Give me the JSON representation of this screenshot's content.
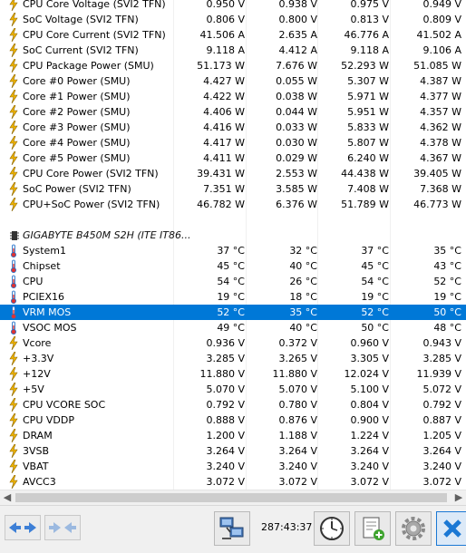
{
  "rows": [
    {
      "icon": "bolt-icon",
      "label": "CPU Core Voltage (SVI2 TFN)",
      "values": [
        "0.950 V",
        "0.938 V",
        "0.975 V",
        "0.949 V"
      ]
    },
    {
      "icon": "bolt-icon",
      "label": "SoC Voltage (SVI2 TFN)",
      "values": [
        "0.806 V",
        "0.800 V",
        "0.813 V",
        "0.809 V"
      ]
    },
    {
      "icon": "bolt-icon",
      "label": "CPU Core Current (SVI2 TFN)",
      "values": [
        "41.506 A",
        "2.635 A",
        "46.776 A",
        "41.502 A"
      ]
    },
    {
      "icon": "bolt-icon",
      "label": "SoC Current (SVI2 TFN)",
      "values": [
        "9.118 A",
        "4.412 A",
        "9.118 A",
        "9.106 A"
      ]
    },
    {
      "icon": "bolt-icon",
      "label": "CPU Package Power (SMU)",
      "values": [
        "51.173 W",
        "7.676 W",
        "52.293 W",
        "51.085 W"
      ]
    },
    {
      "icon": "bolt-icon",
      "label": "Core #0 Power (SMU)",
      "values": [
        "4.427 W",
        "0.055 W",
        "5.307 W",
        "4.387 W"
      ]
    },
    {
      "icon": "bolt-icon",
      "label": "Core #1 Power (SMU)",
      "values": [
        "4.422 W",
        "0.038 W",
        "5.971 W",
        "4.377 W"
      ]
    },
    {
      "icon": "bolt-icon",
      "label": "Core #2 Power (SMU)",
      "values": [
        "4.406 W",
        "0.044 W",
        "5.951 W",
        "4.357 W"
      ]
    },
    {
      "icon": "bolt-icon",
      "label": "Core #3 Power (SMU)",
      "values": [
        "4.416 W",
        "0.033 W",
        "5.833 W",
        "4.362 W"
      ]
    },
    {
      "icon": "bolt-icon",
      "label": "Core #4 Power (SMU)",
      "values": [
        "4.417 W",
        "0.030 W",
        "5.807 W",
        "4.378 W"
      ]
    },
    {
      "icon": "bolt-icon",
      "label": "Core #5 Power (SMU)",
      "values": [
        "4.411 W",
        "0.029 W",
        "6.240 W",
        "4.367 W"
      ]
    },
    {
      "icon": "bolt-icon",
      "label": "CPU Core Power (SVI2 TFN)",
      "values": [
        "39.431 W",
        "2.553 W",
        "44.438 W",
        "39.405 W"
      ]
    },
    {
      "icon": "bolt-icon",
      "label": "SoC Power (SVI2 TFN)",
      "values": [
        "7.351 W",
        "3.585 W",
        "7.408 W",
        "7.368 W"
      ]
    },
    {
      "icon": "bolt-icon",
      "label": "CPU+SoC Power (SVI2 TFN)",
      "values": [
        "46.782 W",
        "6.376 W",
        "51.789 W",
        "46.773 W"
      ]
    },
    {
      "type": "blank"
    },
    {
      "type": "header",
      "icon": "chip-icon",
      "label": "GIGABYTE B450M S2H (ITE IT86..."
    },
    {
      "icon": "thermometer-icon",
      "label": "System1",
      "values": [
        "37 °C",
        "32 °C",
        "37 °C",
        "35 °C"
      ]
    },
    {
      "icon": "thermometer-icon",
      "label": "Chipset",
      "values": [
        "45 °C",
        "40 °C",
        "45 °C",
        "43 °C"
      ]
    },
    {
      "icon": "thermometer-icon",
      "label": "CPU",
      "values": [
        "54 °C",
        "26 °C",
        "54 °C",
        "52 °C"
      ]
    },
    {
      "icon": "thermometer-icon",
      "label": "PCIEX16",
      "values": [
        "19 °C",
        "18 °C",
        "19 °C",
        "19 °C"
      ]
    },
    {
      "icon": "thermometer-icon",
      "label": "VRM MOS",
      "values": [
        "52 °C",
        "35 °C",
        "52 °C",
        "50 °C"
      ],
      "selected": true
    },
    {
      "icon": "thermometer-icon",
      "label": "VSOC MOS",
      "values": [
        "49 °C",
        "40 °C",
        "50 °C",
        "48 °C"
      ]
    },
    {
      "icon": "bolt-icon",
      "label": "Vcore",
      "values": [
        "0.936 V",
        "0.372 V",
        "0.960 V",
        "0.943 V"
      ]
    },
    {
      "icon": "bolt-icon",
      "label": "+3.3V",
      "values": [
        "3.285 V",
        "3.265 V",
        "3.305 V",
        "3.285 V"
      ]
    },
    {
      "icon": "bolt-icon",
      "label": "+12V",
      "values": [
        "11.880 V",
        "11.880 V",
        "12.024 V",
        "11.939 V"
      ]
    },
    {
      "icon": "bolt-icon",
      "label": "+5V",
      "values": [
        "5.070 V",
        "5.070 V",
        "5.100 V",
        "5.072 V"
      ]
    },
    {
      "icon": "bolt-icon",
      "label": "CPU VCORE SOC",
      "values": [
        "0.792 V",
        "0.780 V",
        "0.804 V",
        "0.792 V"
      ]
    },
    {
      "icon": "bolt-icon",
      "label": "CPU VDDP",
      "values": [
        "0.888 V",
        "0.876 V",
        "0.900 V",
        "0.887 V"
      ]
    },
    {
      "icon": "bolt-icon",
      "label": "DRAM",
      "values": [
        "1.200 V",
        "1.188 V",
        "1.224 V",
        "1.205 V"
      ]
    },
    {
      "icon": "bolt-icon",
      "label": "3VSB",
      "values": [
        "3.264 V",
        "3.264 V",
        "3.264 V",
        "3.264 V"
      ]
    },
    {
      "icon": "bolt-icon",
      "label": "VBAT",
      "values": [
        "3.240 V",
        "3.240 V",
        "3.240 V",
        "3.240 V"
      ]
    },
    {
      "icon": "bolt-icon",
      "label": "AVCC3",
      "values": [
        "3.072 V",
        "3.072 V",
        "3.072 V",
        "3.072 V"
      ]
    }
  ],
  "toolbar": {
    "elapsed_time": "287:43:37"
  },
  "colors": {
    "selection": "#0078d7",
    "bolt": "#f0b400",
    "thermometer": "#1f6fc8",
    "close_button": "#1b78d4"
  }
}
